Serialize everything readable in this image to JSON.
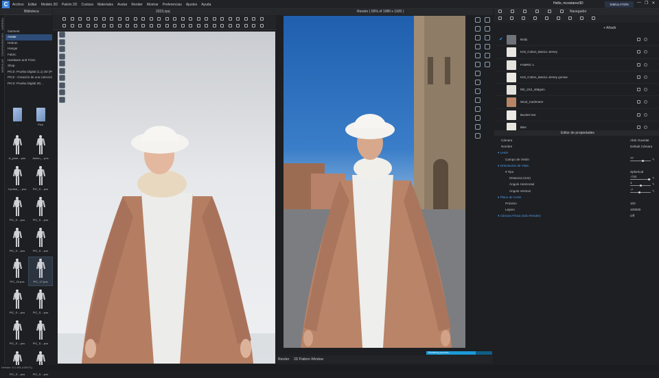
{
  "app": {
    "logo": "C",
    "user": "Hello, mcostarez3D",
    "simulation": "SIMULATION",
    "window_buttons": [
      "—",
      "❐",
      "✕"
    ]
  },
  "menu": [
    "Archivo",
    "Editar",
    "Modelo 3D",
    "Patrón 2D",
    "Costura",
    "Materiales",
    "Avatar",
    "Render",
    "Mostrar",
    "Preferencias",
    "Ajustes",
    "Ayuda"
  ],
  "library": {
    "title": "Biblioteca",
    "vertical_tabs": [
      "LIBRERÍA",
      "CONFIGURACIÓN",
      "MODULAR"
    ],
    "tree": [
      "Garment",
      "Avatar",
      "Hebras",
      "Hangar",
      "Fabric",
      "Hardware and Trims",
      "Shop",
      "PICS: Prueba Digital (1,1) 3D (Prod1)",
      "PICZ - Creación de una colección...",
      "PICS: Prueba Digital 2D..."
    ],
    "selected_tree_index": 1,
    "thumbnails": [
      {
        "label": "..",
        "kind": "folder"
      },
      {
        "label": "Plus",
        "kind": "folder"
      },
      {
        "label": "A_pose....pos",
        "kind": "pose"
      },
      {
        "label": "Action_...pos",
        "kind": "pose"
      },
      {
        "label": "Cymbal_....pos",
        "kind": "pose"
      },
      {
        "label": "PIC_S....pos",
        "kind": "pose"
      },
      {
        "label": "PIC_S....pos",
        "kind": "pose"
      },
      {
        "label": "PIC_S....pos",
        "kind": "pose"
      },
      {
        "label": "PIC_S....pos",
        "kind": "pose"
      },
      {
        "label": "PIC_S....pos",
        "kind": "pose"
      },
      {
        "label": "PIC_16.pos",
        "kind": "pose"
      },
      {
        "label": "PIC_17.pos",
        "kind": "pose"
      },
      {
        "label": "PIC_S....pos",
        "kind": "pose"
      },
      {
        "label": "PIC_S....pos",
        "kind": "pose"
      },
      {
        "label": "PIC_S....pos",
        "kind": "pose"
      },
      {
        "label": "PIC_S....pos",
        "kind": "pose"
      },
      {
        "label": "PIC_S....pos",
        "kind": "pose"
      },
      {
        "label": "PIC_S....pos",
        "kind": "pose"
      }
    ],
    "selected_thumb_index": 11
  },
  "viewport3d": {
    "title": "2023.zprj"
  },
  "render": {
    "title": "Render ( 65% of 1080 x 1920 )",
    "tab_render": "Render",
    "tab_pattern": "2D Pattern Window",
    "progress": 0.75,
    "progress_label": "Rendering process..."
  },
  "navigator": {
    "title": "Navegador",
    "add_label": "+ Añadir"
  },
  "materials": [
    {
      "name": "Body",
      "color": "#6f747b",
      "checked": true
    },
    {
      "name": "Knit_Cotton_Basico Jersey",
      "color": "#e9e6e1",
      "checked": false
    },
    {
      "name": "FABRIC 1",
      "color": "#e6e3de",
      "checked": false
    },
    {
      "name": "Knit_Cotton_Basico Jersey gomas",
      "color": "#ebe8e3",
      "checked": false
    },
    {
      "name": "Rib_2X2_468gsm",
      "color": "#e4e1dc",
      "checked": false
    },
    {
      "name": "Wool_Cashmere",
      "color": "#b88466",
      "checked": false
    },
    {
      "name": "Bucket Hat",
      "color": "#ece9e4",
      "checked": false
    },
    {
      "name": "Bies",
      "color": "#e8e5e0",
      "checked": false
    }
  ],
  "property_editor": {
    "title": "Editor de propiedades",
    "rows": [
      {
        "key": "Cámara",
        "value": "Abrir  Guardar",
        "kind": "plain"
      },
      {
        "key": "Nombre",
        "value": "Default Cámara",
        "kind": "plain"
      },
      {
        "key": "Lente",
        "value": "",
        "kind": "section"
      },
      {
        "key": "Campo de Visión",
        "value": "77",
        "kind": "slider",
        "level": 0.6
      },
      {
        "key": "Orientación de Vista",
        "value": "",
        "kind": "section"
      },
      {
        "key": "Tipo",
        "value": "Spherical",
        "kind": "sub"
      },
      {
        "key": "Distancia (mm)",
        "value": "-710",
        "kind": "slider2",
        "level": 0.9
      },
      {
        "key": "Ángulo Horizontal",
        "value": "1",
        "kind": "slider2",
        "level": 0.5
      },
      {
        "key": "Ángulo Vertical",
        "value": "-7",
        "kind": "slider2",
        "level": 0.45
      },
      {
        "key": "Plano de Corte",
        "value": "",
        "kind": "section"
      },
      {
        "key": "Próximo",
        "value": "100",
        "kind": "plain2"
      },
      {
        "key": "Lejano",
        "value": "100000",
        "kind": "plain2"
      },
      {
        "key": "Cámara Física (solo Render)",
        "value": "Off",
        "kind": "section"
      }
    ]
  },
  "status": "Versión: 6.1.391 (r30471)",
  "colors": {
    "accent": "#3b8ee6",
    "progress": "#1b9ad8",
    "coat": "#b57e63"
  }
}
